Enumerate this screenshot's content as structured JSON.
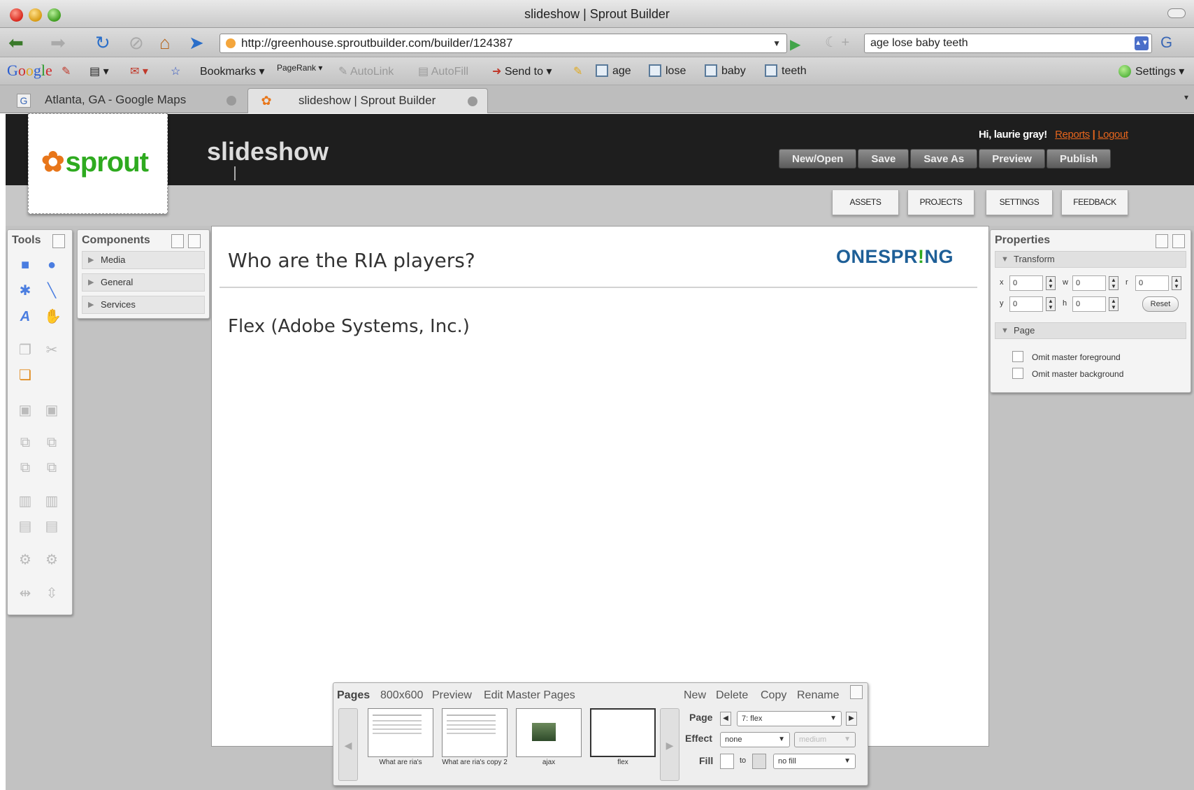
{
  "browser": {
    "window_title": "slideshow | Sprout Builder",
    "url": "http://greenhouse.sproutbuilder.com/builder/124387",
    "search_text": "age lose baby teeth",
    "toolbar": {
      "bookmarks": "Bookmarks",
      "pagerank": "PageRank",
      "autolink": "AutoLink",
      "autofill": "AutoFill",
      "send_to": "Send to",
      "terms": [
        "age",
        "lose",
        "baby",
        "teeth"
      ],
      "settings": "Settings"
    },
    "tabs": [
      {
        "label": "Atlanta, GA - Google Maps"
      },
      {
        "label": "slideshow | Sprout Builder"
      }
    ]
  },
  "app": {
    "logo": "sprout",
    "project_title": "slideshow",
    "greeting": "Hi, laurie gray!",
    "reports_link": "Reports",
    "separator": "|",
    "logout_link": "Logout",
    "header_buttons": [
      "New/Open",
      "Save",
      "Save As",
      "Preview",
      "Publish"
    ],
    "sub_tabs": [
      "ASSETS",
      "PROJECTS",
      "SETTINGS",
      "FEEDBACK"
    ]
  },
  "tools": {
    "title": "Tools"
  },
  "components": {
    "title": "Components",
    "items": [
      "Media",
      "General",
      "Services"
    ]
  },
  "slide": {
    "title": "Who are the RIA players?",
    "brand_left": "ONESPR",
    "brand_accent": "!",
    "brand_right": "NG",
    "body": "Flex (Adobe Systems, Inc.)"
  },
  "properties": {
    "title": "Properties",
    "transform_label": "Transform",
    "fields": {
      "x": {
        "label": "x",
        "value": "0"
      },
      "w": {
        "label": "w",
        "value": "0"
      },
      "r": {
        "label": "r",
        "value": "0"
      },
      "y": {
        "label": "y",
        "value": "0"
      },
      "h": {
        "label": "h",
        "value": "0"
      }
    },
    "reset_label": "Reset",
    "page_label": "Page",
    "checkboxes": [
      "Omit master foreground",
      "Omit master background"
    ]
  },
  "pages": {
    "title": "Pages",
    "size": "800x600",
    "preview": "Preview",
    "edit_master": "Edit Master Pages",
    "actions": [
      "New",
      "Delete",
      "Copy",
      "Rename"
    ],
    "thumbnails": [
      {
        "label": "What are ria's"
      },
      {
        "label": "What are ria's copy 2"
      },
      {
        "label": "ajax"
      },
      {
        "label": "flex"
      }
    ],
    "page_label": "Page",
    "page_value": "7: flex",
    "effect_label": "Effect",
    "effect_value": "none",
    "speed_value": "medium",
    "fill_label": "Fill",
    "fill_to": "to",
    "fill_value": "no fill"
  },
  "colors": {
    "header_bg": "#1e1e1e",
    "sprout_green": "#2eaa1f",
    "link_orange": "#e5651d",
    "brand_blue": "#1e5f97"
  }
}
